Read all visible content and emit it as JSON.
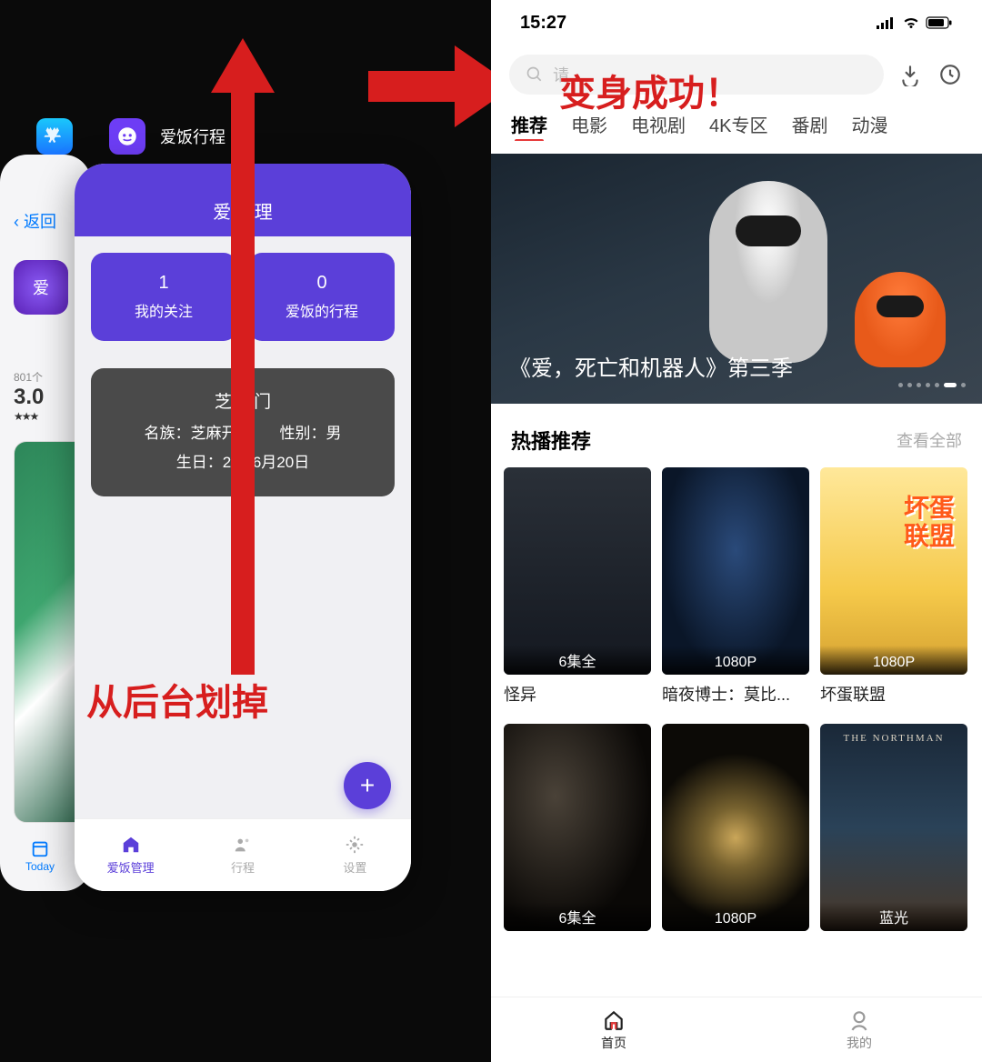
{
  "annotations": {
    "swipe_away": "从后台划掉",
    "transform_success": "变身成功！"
  },
  "left_switcher": {
    "app_label": "爱饭行程",
    "bg_app": {
      "back_label": "返回",
      "avatar_text": "爱",
      "meta": "801个",
      "rating": "3.0",
      "stars": "★★★",
      "today_label": "Today"
    },
    "fg_app": {
      "header_title": "爱饭   理",
      "stats": [
        {
          "num": "1",
          "label": "我的关注"
        },
        {
          "num": "0",
          "label": "爱饭的行程"
        }
      ],
      "info": {
        "name": "芝麻   门",
        "clan_label": "名族：",
        "clan": "芝麻开门",
        "gender_label": "性别：",
        "gender": "男",
        "birth_label": "生日：",
        "birth": "202   6月20日"
      },
      "fab": "+",
      "tabs": [
        {
          "label": "爱饭管理",
          "active": true
        },
        {
          "label": "行程",
          "active": false
        },
        {
          "label": "设置",
          "active": false
        }
      ]
    }
  },
  "right_app": {
    "status": {
      "time": "15:27"
    },
    "search_placeholder": "请",
    "header_icons": [
      "download",
      "history"
    ],
    "categories": [
      {
        "label": "推荐",
        "active": true
      },
      {
        "label": "电影",
        "active": false
      },
      {
        "label": "电视剧",
        "active": false
      },
      {
        "label": "4K专区",
        "active": false
      },
      {
        "label": "番剧",
        "active": false
      },
      {
        "label": "动漫",
        "active": false
      }
    ],
    "banner": {
      "title": "《爱，死亡和机器人》第三季"
    },
    "section": {
      "title": "热播推荐",
      "more": "查看全部"
    },
    "posters_row1": [
      {
        "badge": "6集全",
        "title": "怪异"
      },
      {
        "badge": "1080P",
        "title": "暗夜博士：莫比..."
      },
      {
        "badge": "1080P",
        "title": "坏蛋联盟"
      }
    ],
    "posters_row2": [
      {
        "badge": "6集全",
        "title": ""
      },
      {
        "badge": "1080P",
        "title": ""
      },
      {
        "badge": "蓝光",
        "title": ""
      }
    ],
    "bottom_nav": [
      {
        "label": "首页",
        "active": true
      },
      {
        "label": "我的",
        "active": false
      }
    ]
  }
}
